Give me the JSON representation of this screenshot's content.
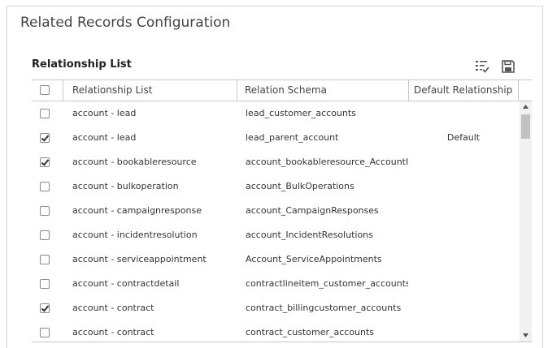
{
  "panel": {
    "title": "Related Records Configuration"
  },
  "list": {
    "title": "Relationship List"
  },
  "toolbar": {
    "select_icon": "checklist-icon",
    "save_icon": "save-icon"
  },
  "columns": {
    "relationship": "Relationship List",
    "schema": "Relation Schema",
    "default": "Default Relationship"
  },
  "rows": [
    {
      "checked": false,
      "relationship": "account - lead",
      "schema": "lead_customer_accounts",
      "default": ""
    },
    {
      "checked": true,
      "relationship": "account - lead",
      "schema": "lead_parent_account",
      "default": "Default"
    },
    {
      "checked": true,
      "relationship": "account - bookableresource",
      "schema": "account_bookableresource_AccountId",
      "default": ""
    },
    {
      "checked": false,
      "relationship": "account - bulkoperation",
      "schema": "account_BulkOperations",
      "default": ""
    },
    {
      "checked": false,
      "relationship": "account - campaignresponse",
      "schema": "account_CampaignResponses",
      "default": ""
    },
    {
      "checked": false,
      "relationship": "account - incidentresolution",
      "schema": "account_IncidentResolutions",
      "default": ""
    },
    {
      "checked": false,
      "relationship": "account - serviceappointment",
      "schema": "Account_ServiceAppointments",
      "default": ""
    },
    {
      "checked": false,
      "relationship": "account - contractdetail",
      "schema": "contractlineitem_customer_accounts",
      "default": ""
    },
    {
      "checked": true,
      "relationship": "account - contract",
      "schema": "contract_billingcustomer_accounts",
      "default": ""
    },
    {
      "checked": false,
      "relationship": "account - contract",
      "schema": "contract_customer_accounts",
      "default": ""
    }
  ],
  "colors": {
    "border": "#c8c8c8",
    "text": "#333333",
    "scroll_thumb": "#c1c1c1"
  }
}
